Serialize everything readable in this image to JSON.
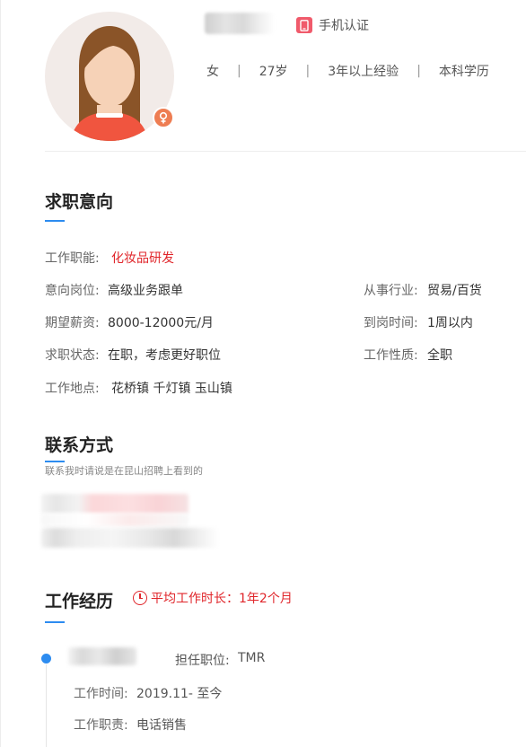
{
  "profile": {
    "verify_label": "手机认证",
    "gender": "女",
    "age": "27岁",
    "experience": "3年以上经验",
    "education": "本科学历",
    "sep": "|"
  },
  "intent": {
    "title": "求职意向",
    "function_label": "工作职能:",
    "function_value": "化妆品研发",
    "position_label": "意向岗位:",
    "position_value": "高级业务跟单",
    "industry_label": "从事行业:",
    "industry_value": "贸易/百货",
    "salary_label": "期望薪资:",
    "salary_value": "8000-12000元/月",
    "arrival_label": "到岗时间:",
    "arrival_value": "1周以内",
    "status_label": "求职状态:",
    "status_value": "在职，考虑更好职位",
    "nature_label": "工作性质:",
    "nature_value": "全职",
    "location_label": "工作地点:",
    "location_value": "花桥镇 千灯镇 玉山镇"
  },
  "contact": {
    "title": "联系方式",
    "hint": "联系我时请说是在昆山招聘上看到的"
  },
  "experience": {
    "title": "工作经历",
    "avg_duration": "平均工作时长：1年2个月",
    "item": {
      "position_label": "担任职位:",
      "position_value": "TMR",
      "time_label": "工作时间:",
      "time_value": "2019.11- 至今",
      "duty_label": "工作职责:",
      "duty_value": "电话销售"
    }
  },
  "colors": {
    "accent_blue": "#2d8cf0",
    "accent_red": "#e0262b",
    "badge_orange": "#ee7d52"
  }
}
